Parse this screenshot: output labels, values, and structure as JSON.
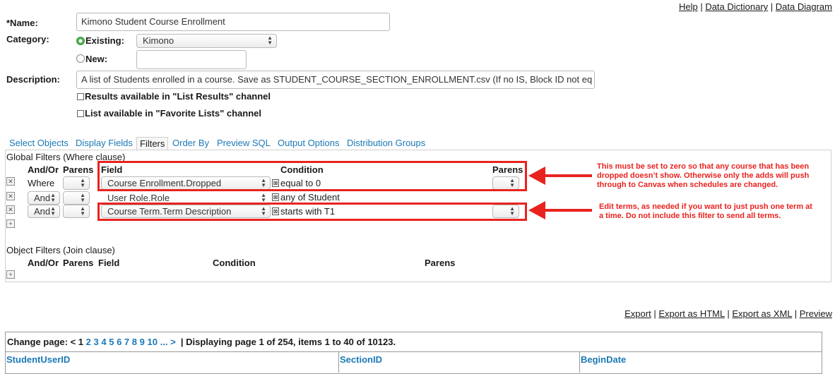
{
  "toplinks": [
    "Help",
    "Data Dictionary",
    "Data Diagram"
  ],
  "form": {
    "name_label": "*Name:",
    "name_value": "Kimono Student Course Enrollment",
    "category_label": "Category:",
    "existing_label": "Existing:",
    "existing_value": "Kimono",
    "new_label": "New:",
    "new_value": "",
    "description_label": "Description:",
    "description_value": "A list of Students enrolled in a course. Save as STUDENT_COURSE_SECTION_ENROLLMENT.csv (If no IS, Block ID not eq",
    "results_label": "Results available in \"List Results\" channel",
    "favorites_label": "List available in \"Favorite Lists\" channel"
  },
  "tabs": [
    "Select Objects",
    "Display Fields",
    "Filters",
    "Order By",
    "Preview SQL",
    "Output Options",
    "Distribution Groups"
  ],
  "global": {
    "title": "Global Filters (Where clause)",
    "headers": {
      "andor": "And/Or",
      "parens": "Parens",
      "field": "Field",
      "condition": "Condition",
      "parens2": "Parens"
    },
    "rows": [
      {
        "andor": "Where",
        "field": "Course Enrollment.Dropped",
        "condition": "equal to 0"
      },
      {
        "andor": "And",
        "field": "User Role.Role",
        "condition": "any of Student"
      },
      {
        "andor": "And",
        "field": "Course Term.Term Description",
        "condition": "starts with T1"
      }
    ]
  },
  "object": {
    "title": "Object Filters (Join clause)",
    "headers": {
      "andor": "And/Or",
      "parens": "Parens",
      "field": "Field",
      "condition": "Condition",
      "parens2": "Parens"
    }
  },
  "annotations": [
    "This must be set to zero so that any course that has been dropped doesn’t show. Otherwise only the adds will push through to Canvas when schedules are changed.",
    "Edit terms, as needed if you want to just push one term at a time. Do not include this filter to send all terms."
  ],
  "export_links": [
    "Export",
    "Export as HTML",
    "Export as XML",
    "Preview"
  ],
  "pager": {
    "prefix": "Change page: < 1",
    "pages": [
      "2",
      "3",
      "4",
      "5",
      "6",
      "7",
      "8",
      "9",
      "10",
      "...",
      ">"
    ],
    "summary": "|  Displaying page 1 of 254, items 1 to 40 of 10123."
  },
  "columns": [
    "StudentUserID",
    "SectionID",
    "BeginDate"
  ],
  "colors": {
    "link": "#1b79b5",
    "annotation": "#e8231f"
  }
}
